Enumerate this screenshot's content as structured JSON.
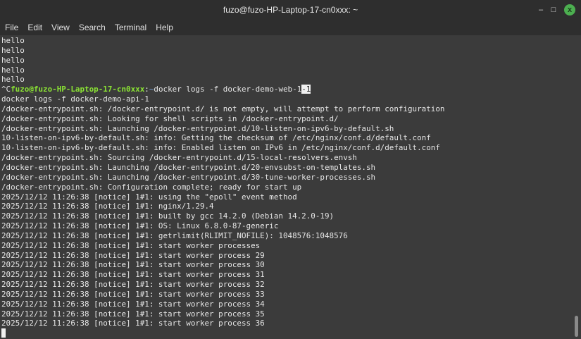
{
  "window": {
    "title": "fuzo@fuzo-HP-Laptop-17-cn0xxx: ~",
    "minimize": "–",
    "maximize": "□",
    "close": "x"
  },
  "menu": [
    "File",
    "Edit",
    "View",
    "Search",
    "Terminal",
    "Help"
  ],
  "prompt": {
    "ctrl": "^C",
    "userhost": "fuzo@fuzo-HP-Laptop-17-cn0xxx",
    "colon": ":",
    "path": "~",
    "command": "docker logs -f docker-demo-web-1",
    "highlight": "-1"
  },
  "lines_before": [
    "hello",
    "hello",
    "hello",
    "hello",
    "hello"
  ],
  "lines_after": [
    "docker logs -f docker-demo-api-1",
    "/docker-entrypoint.sh: /docker-entrypoint.d/ is not empty, will attempt to perform configuration",
    "/docker-entrypoint.sh: Looking for shell scripts in /docker-entrypoint.d/",
    "/docker-entrypoint.sh: Launching /docker-entrypoint.d/10-listen-on-ipv6-by-default.sh",
    "10-listen-on-ipv6-by-default.sh: info: Getting the checksum of /etc/nginx/conf.d/default.conf",
    "10-listen-on-ipv6-by-default.sh: info: Enabled listen on IPv6 in /etc/nginx/conf.d/default.conf",
    "/docker-entrypoint.sh: Sourcing /docker-entrypoint.d/15-local-resolvers.envsh",
    "/docker-entrypoint.sh: Launching /docker-entrypoint.d/20-envsubst-on-templates.sh",
    "/docker-entrypoint.sh: Launching /docker-entrypoint.d/30-tune-worker-processes.sh",
    "/docker-entrypoint.sh: Configuration complete; ready for start up",
    "2025/12/12 11:26:38 [notice] 1#1: using the \"epoll\" event method",
    "2025/12/12 11:26:38 [notice] 1#1: nginx/1.29.4",
    "2025/12/12 11:26:38 [notice] 1#1: built by gcc 14.2.0 (Debian 14.2.0-19)",
    "2025/12/12 11:26:38 [notice] 1#1: OS: Linux 6.8.0-87-generic",
    "2025/12/12 11:26:38 [notice] 1#1: getrlimit(RLIMIT_NOFILE): 1048576:1048576",
    "2025/12/12 11:26:38 [notice] 1#1: start worker processes",
    "2025/12/12 11:26:38 [notice] 1#1: start worker process 29",
    "2025/12/12 11:26:38 [notice] 1#1: start worker process 30",
    "2025/12/12 11:26:38 [notice] 1#1: start worker process 31",
    "2025/12/12 11:26:38 [notice] 1#1: start worker process 32",
    "2025/12/12 11:26:38 [notice] 1#1: start worker process 33",
    "2025/12/12 11:26:38 [notice] 1#1: start worker process 34",
    "2025/12/12 11:26:38 [notice] 1#1: start worker process 35",
    "2025/12/12 11:26:38 [notice] 1#1: start worker process 36"
  ]
}
